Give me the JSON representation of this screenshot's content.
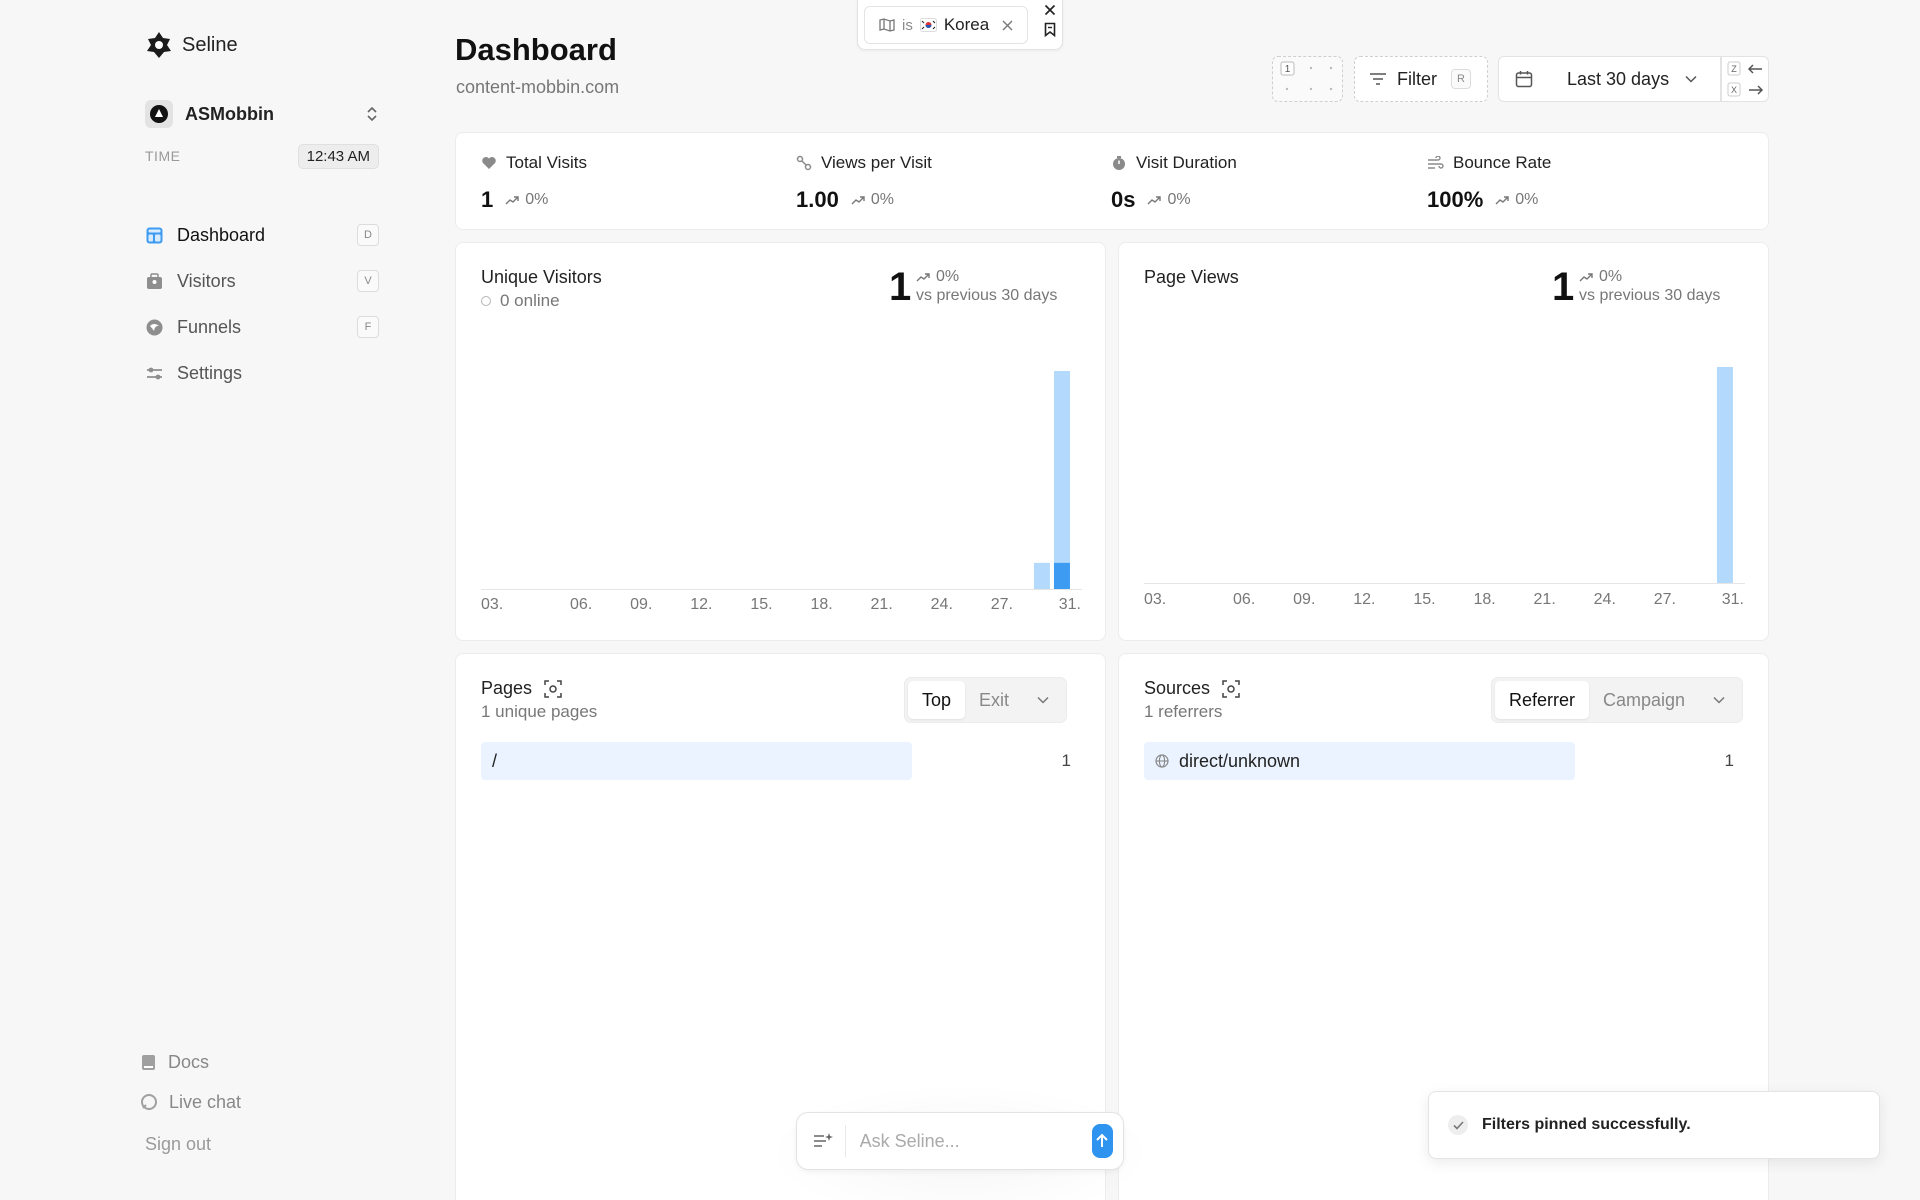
{
  "brand": {
    "name": "Seline"
  },
  "workspace": {
    "name": "ASMobbin"
  },
  "time": {
    "label": "TIME",
    "value": "12:43 AM"
  },
  "nav": [
    {
      "label": "Dashboard",
      "key": "D",
      "icon": "dashboard-icon",
      "active": true
    },
    {
      "label": "Visitors",
      "key": "V",
      "icon": "visitors-icon",
      "active": false
    },
    {
      "label": "Funnels",
      "key": "F",
      "icon": "funnels-icon",
      "active": false
    },
    {
      "label": "Settings",
      "key": "",
      "icon": "settings-icon",
      "active": false
    }
  ],
  "sidebar_bottom": {
    "docs": "Docs",
    "live_chat": "Live chat",
    "sign_out": "Sign out"
  },
  "header": {
    "title": "Dashboard",
    "subtitle": "content-mobbin.com"
  },
  "active_filter": {
    "operator": "is",
    "value": "Korea",
    "icon": "map-icon"
  },
  "toolbar": {
    "grid_label": "1",
    "filter_label": "Filter",
    "filter_key": "R",
    "range_label": "Last 30 days",
    "prev_key": "Z",
    "next_key": "X"
  },
  "stats": [
    {
      "label": "Total Visits",
      "value": "1",
      "delta": "0%",
      "icon": "visits-icon"
    },
    {
      "label": "Views per Visit",
      "value": "1.00",
      "delta": "0%",
      "icon": "views-icon"
    },
    {
      "label": "Visit Duration",
      "value": "0s",
      "delta": "0%",
      "icon": "timer-icon"
    },
    {
      "label": "Bounce Rate",
      "value": "100%",
      "delta": "0%",
      "icon": "bounce-icon"
    }
  ],
  "visitors_chart": {
    "title": "Unique Visitors",
    "online": "0 online",
    "total": "1",
    "delta": "0%",
    "compare": "vs previous 30 days"
  },
  "pageviews_chart": {
    "title": "Page Views",
    "total": "1",
    "delta": "0%",
    "compare": "vs previous 30 days"
  },
  "chart_data": [
    {
      "type": "bar",
      "title": "Unique Visitors",
      "xlabel": "",
      "ylabel": "",
      "tick_labels": [
        "03.",
        "06.",
        "09.",
        "12.",
        "15.",
        "18.",
        "21.",
        "24.",
        "27.",
        "31."
      ],
      "x": [
        29,
        30
      ],
      "series": [
        {
          "values": [
            0.12,
            1
          ]
        },
        {
          "values": [
            0,
            0.12
          ]
        }
      ],
      "ylim": [
        0,
        1
      ],
      "grid": false,
      "colors": {
        "light": "#b3dafc",
        "dark": "#3d9cf2"
      }
    },
    {
      "type": "bar",
      "title": "Page Views",
      "xlabel": "",
      "ylabel": "",
      "tick_labels": [
        "03.",
        "06.",
        "09.",
        "12.",
        "15.",
        "18.",
        "21.",
        "24.",
        "27.",
        "31."
      ],
      "x": [
        30
      ],
      "series": [
        {
          "values": [
            1
          ]
        }
      ],
      "ylim": [
        0,
        1
      ],
      "grid": false,
      "colors": {
        "light": "#b3dafc"
      }
    }
  ],
  "pages": {
    "title": "Pages",
    "subtitle": "1 unique pages",
    "tabs": [
      "Top",
      "Exit"
    ],
    "active_tab": "Top",
    "rows": [
      {
        "label": "/",
        "count": "1"
      }
    ]
  },
  "sources": {
    "title": "Sources",
    "subtitle": "1 referrers",
    "tabs": [
      "Referrer",
      "Campaign"
    ],
    "active_tab": "Referrer",
    "rows": [
      {
        "label": "direct/unknown",
        "count": "1"
      }
    ]
  },
  "ask": {
    "placeholder": "Ask Seline..."
  },
  "toast": {
    "message": "Filters pinned successfully."
  },
  "colors": {
    "accent": "#2f93f0",
    "bar_light": "#b3dafc",
    "bar_dark": "#3d9cf2",
    "row_highlight": "#eaf3ff"
  }
}
